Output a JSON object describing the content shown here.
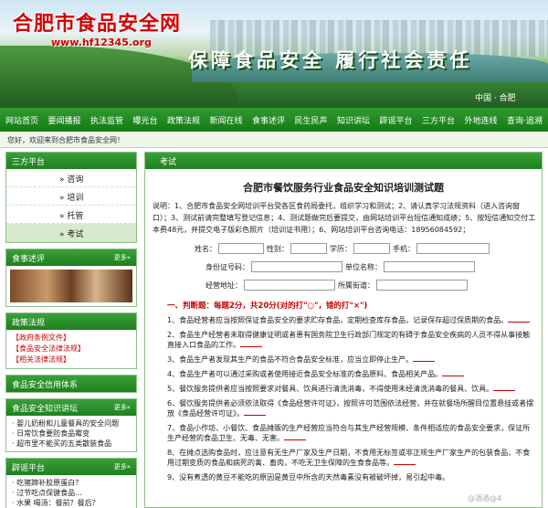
{
  "site": {
    "title": "合肥市食品安全网",
    "url": "www.hf12345.org",
    "slogan": "保障食品安全  履行社会责任",
    "banner_mark": "中国 · 合肥"
  },
  "nav": [
    "网站首页",
    "要闻播报",
    "执法监管",
    "曝光台",
    "政策法规",
    "新闻在线",
    "食事述评",
    "民生民声",
    "知识讲坛",
    "辟谣平台",
    "三方平台",
    "外地连线",
    "查询·追溯"
  ],
  "welcome": "您好，欢迎来到合肥市食品安全网！",
  "sidebar": {
    "platform_title": "三方平台",
    "menu": [
      "» 咨询",
      "» 培训",
      "» 托管",
      "» 考试"
    ],
    "review_title": "食事述评",
    "more": "更多»",
    "policy_title": "政策法规",
    "policy_items": [
      "【政府条例文件】",
      "【食品安全法律法规】",
      "【相关法律法规】"
    ],
    "credit_title": "食品安全信用体系",
    "lecture_title": "食品安全知识讲坛",
    "lecture_items": [
      "· 婴儿奶粉和儿童餐具的安全问题",
      "· 日常饮食要防食品霉变",
      "· 超市里不能买的五类散装食品"
    ],
    "rumor_title": "辟谣平台",
    "rumor_items": [
      "· 吃猪蹄补胶原蛋白？",
      "· 过节吃点保健食品...",
      "· 水果 喝汤：餐前？餐后？"
    ]
  },
  "main": {
    "tab": "考试",
    "exam_title": "合肥市餐饮服务行业食品安全知识培训测试题",
    "description": "说明：1、合肥市食品安全网培训平台受各区食药局委托，组织学习和测试；2、请认真学习法规资料（进入咨询窗口）；3、测试前请完整填写登记信息；4、测试题做完后要提交，由网站培训平台短信通知成绩；5、按短信通知交付工本费48元，并提交电子版彩色照片（培训证书用）；6、网站培训平台咨询电话：18956084592；",
    "form": {
      "name": "姓名：",
      "gender": "性别：",
      "education": "学历：",
      "phone": "手机：",
      "id_number": "身份证号码：",
      "unit_name": "单位名称：",
      "address": "经营地址：",
      "street": "所属街道："
    },
    "section": "一、判断题：每题2分，共20分(对的打\"○\"，错的打\"×\")",
    "questions": [
      "1、食品经营者应当按照保证食品安全的要求贮存食品，定期检查库存食品，记录保存超过保质期的食品。",
      "2、食品生产经营者未取得健康证明或者患有国务院卫生行政部门规定的有碍于食品安全疾病的人员不得从事接触直接入口食品的工作。",
      "3、食品生产者发现其生产的食品不符合食品安全标准，应当立即停止生产。",
      "4、食品生产者可以通过采购或者使用接近食品安全标准的食品原料、食品相关产品。",
      "5、餐饮服务提供者应当按照要求对餐具、饮具进行清洗消毒，不得使用未经清洗消毒的餐具、饮具。",
      "6、餐饮服务提供者必须依法取得《食品经营许可证》，按照许可范围依法经营，并在就餐场所醒目位置悬挂或者摆放《食品经营许可证》。",
      "7、食品小作坊、小餐饮、食品摊贩的生产经营应当符合与其生产经营规模、条件相适应的食品安全要求，保证所生产经营的食品卫生、无毒、无害。",
      "8、在摊点选购食品时，应注意有无生产厂家及生产日期，不食用无标签或非正规生产厂家生产的包装食品，不食用过期变质的食品和病死的禽、畜肉，不吃无卫生保障的生食食品等。",
      "9、没有煮透的黄豆不能吃的原因是黄豆中所含的天然毒素没有被破坏掉，易引起中毒。"
    ]
  },
  "watermark": "@酒酒@4"
}
